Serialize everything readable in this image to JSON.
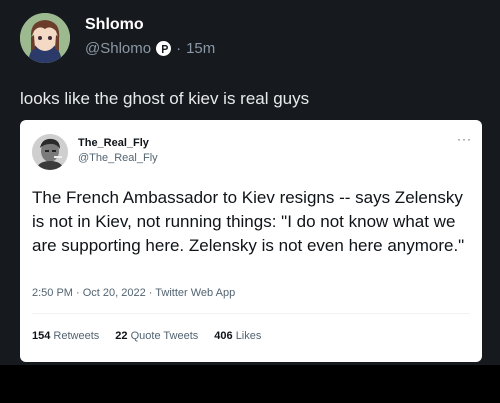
{
  "post": {
    "display_name": "Shlomo",
    "handle": "@Shlomo",
    "time": "15m",
    "separator": "·",
    "text": "looks like the ghost of kiev is real guys"
  },
  "embed": {
    "display_name": "The_Real_Fly",
    "handle": "@The_Real_Fly",
    "body": "The French Ambassador to Kiev resigns --  says Zelensky is not in Kiev, not running things: \"I do not know what we are supporting here. Zelensky is not even here anymore.\"",
    "meta": "2:50 PM · Oct 20, 2022 · Twitter Web App",
    "retweets_count": "154",
    "retweets_label": "Retweets",
    "quotes_count": "22",
    "quotes_label": "Quote Tweets",
    "likes_count": "406",
    "likes_label": "Likes",
    "more_glyph": "···"
  },
  "colors": {
    "background": "#16191d",
    "text_primary": "#e7e9ea",
    "text_secondary": "#8b98a5",
    "embed_background": "#ffffff"
  }
}
